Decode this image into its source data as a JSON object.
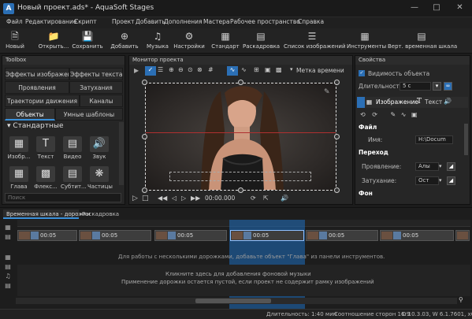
{
  "window": {
    "title": "Новый проект.ads* - AquaSoft Stages",
    "app_icon": "aquasoft-logo-icon",
    "accent_color": "#3a8fd8"
  },
  "menu": [
    "Файл",
    "Редактирование",
    "Скрипт",
    "Проект",
    "Добавить",
    "Дополнения",
    "Мастера",
    "Рабочее пространство",
    "Справка"
  ],
  "toolbar": {
    "new": "Новый",
    "open": "Открыть...",
    "save": "Сохранить",
    "add": "Добавить",
    "music": "Музыка",
    "settings": "Настройки",
    "standard": "Стандарт",
    "storyboard": "Раскадровка",
    "image_list": "Список изображений",
    "tools": "Инструменты",
    "vertical_timeline": "Верт. временная шкала"
  },
  "toolbox": {
    "title": "Toolbox",
    "tabs_row1": [
      "Эффекты изображений",
      "Эффекты текста"
    ],
    "tabs_row2": [
      "Проявления",
      "Затухания"
    ],
    "tabs_row3": [
      "Траектории движения",
      "Каналы"
    ],
    "tabs_row4": [
      "Объекты",
      "Умные шаблоны"
    ],
    "section": "Стандартные",
    "items_row1": [
      "Изобр...",
      "Текст",
      "Видео",
      "Звук"
    ],
    "items_row2": [
      "Глава",
      "Флекс...",
      "Субтит...",
      "Частицы"
    ],
    "search_placeholder": "Поиск"
  },
  "monitor": {
    "title": "Монитор проекта",
    "marker_label": "Метка времени",
    "timecode": "00:00.000"
  },
  "properties": {
    "title": "Свойства",
    "visibility": "Видимость объекта",
    "duration_label": "Длительность:",
    "duration_value": "5 с",
    "tab_image": "Изображение",
    "tab_text": "Текст",
    "section_file": "Файл",
    "name_label": "Имя:",
    "name_value": "H:\\Docum",
    "section_transition": "Переход",
    "fadein_label": "Проявление:",
    "fadein_value": "Алы",
    "fadeout_label": "Затухание:",
    "fadeout_value": "Ост",
    "section_background": "Фон"
  },
  "timeline": {
    "tab_timeline": "Временная шкала - дорожки",
    "tab_storyboard": "Раскадровка",
    "clips": [
      "00:05",
      "00:05",
      "00:05",
      "00:05",
      "00:05",
      "00:05",
      "00:05"
    ],
    "hint1": "Для работы с несколькими дорожками, добавьте объект \"Глава\" из панели инструментов.",
    "hint2": "Кликните здесь для добавления фоновой музыки",
    "hint3": "Применение дорожки остается пустой, если проект не содержит рамку изображений"
  },
  "status": {
    "duration": "Длительность: 1:40 мин",
    "aspect": "Соотношение сторон 16:9",
    "version": "D 10.3.03, W 6.1.7601, x64"
  }
}
